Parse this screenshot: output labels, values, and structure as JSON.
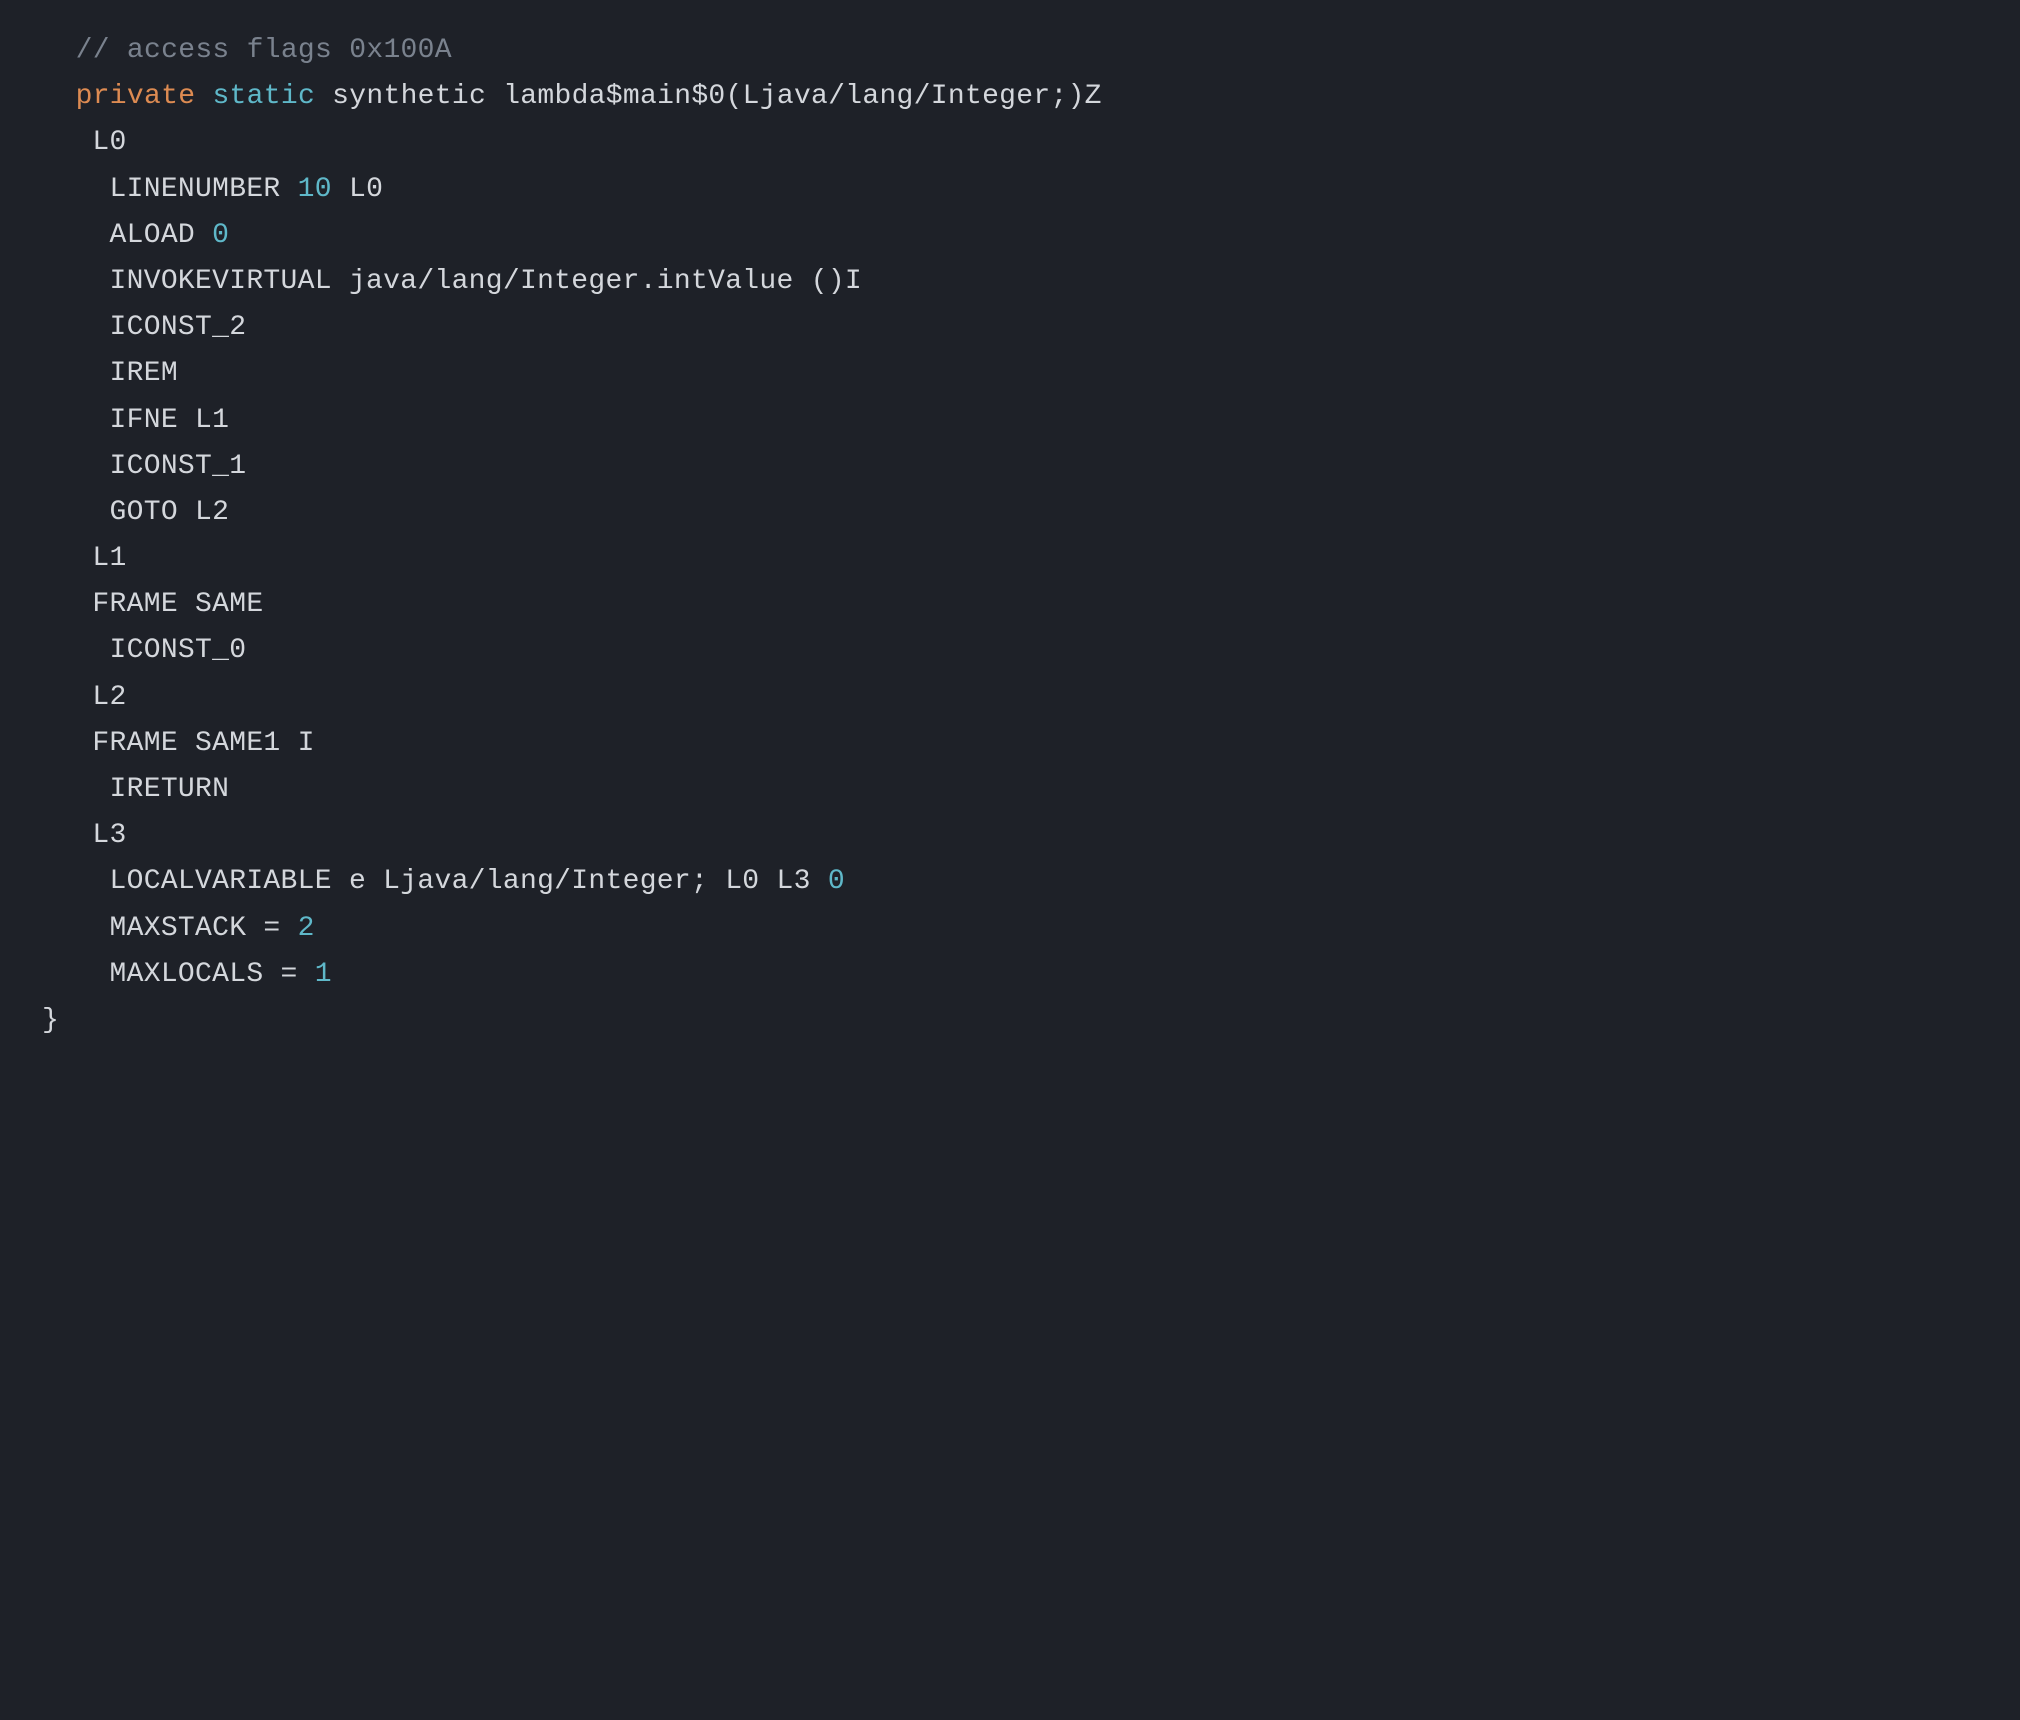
{
  "lines": [
    {
      "indent": "i2",
      "spans": [
        {
          "cls": "comment",
          "text": "// access flags 0x100A"
        }
      ]
    },
    {
      "indent": "i2",
      "spans": [
        {
          "cls": "keyword1",
          "text": "private"
        },
        {
          "cls": "text",
          "text": " "
        },
        {
          "cls": "keyword2",
          "text": "static"
        },
        {
          "cls": "text",
          "text": " synthetic lambda$main$0(Ljava/lang/Integer;)Z"
        }
      ]
    },
    {
      "indent": "i3",
      "spans": [
        {
          "cls": "text",
          "text": "L0"
        }
      ]
    },
    {
      "indent": "i3",
      "spans": [
        {
          "cls": "text",
          "text": " LINENUMBER "
        },
        {
          "cls": "number",
          "text": "10"
        },
        {
          "cls": "text",
          "text": " L0"
        }
      ]
    },
    {
      "indent": "i3",
      "spans": [
        {
          "cls": "text",
          "text": " ALOAD "
        },
        {
          "cls": "number",
          "text": "0"
        }
      ]
    },
    {
      "indent": "i3",
      "spans": [
        {
          "cls": "text",
          "text": " INVOKEVIRTUAL java/lang/Integer.intValue ()I"
        }
      ]
    },
    {
      "indent": "i3",
      "spans": [
        {
          "cls": "text",
          "text": " ICONST_2"
        }
      ]
    },
    {
      "indent": "i3",
      "spans": [
        {
          "cls": "text",
          "text": " IREM"
        }
      ]
    },
    {
      "indent": "i3",
      "spans": [
        {
          "cls": "text",
          "text": " IFNE L1"
        }
      ]
    },
    {
      "indent": "i3",
      "spans": [
        {
          "cls": "text",
          "text": " ICONST_1"
        }
      ]
    },
    {
      "indent": "i3",
      "spans": [
        {
          "cls": "text",
          "text": " GOTO L2"
        }
      ]
    },
    {
      "indent": "i3",
      "spans": [
        {
          "cls": "text",
          "text": "L1"
        }
      ]
    },
    {
      "indent": "i3",
      "spans": [
        {
          "cls": "text",
          "text": "FRAME SAME"
        }
      ]
    },
    {
      "indent": "i3",
      "spans": [
        {
          "cls": "text",
          "text": " ICONST_0"
        }
      ]
    },
    {
      "indent": "i3",
      "spans": [
        {
          "cls": "text",
          "text": "L2"
        }
      ]
    },
    {
      "indent": "i3",
      "spans": [
        {
          "cls": "text",
          "text": "FRAME SAME1 I"
        }
      ]
    },
    {
      "indent": "i3",
      "spans": [
        {
          "cls": "text",
          "text": " IRETURN"
        }
      ]
    },
    {
      "indent": "i3",
      "spans": [
        {
          "cls": "text",
          "text": "L3"
        }
      ]
    },
    {
      "indent": "i3",
      "spans": [
        {
          "cls": "text",
          "text": " LOCALVARIABLE e Ljava/lang/Integer; L0 L3 "
        },
        {
          "cls": "number",
          "text": "0"
        }
      ]
    },
    {
      "indent": "i3",
      "spans": [
        {
          "cls": "text",
          "text": " MAXSTACK = "
        },
        {
          "cls": "number",
          "text": "2"
        }
      ]
    },
    {
      "indent": "i3",
      "spans": [
        {
          "cls": "text",
          "text": " MAXLOCALS = "
        },
        {
          "cls": "number",
          "text": "1"
        }
      ]
    },
    {
      "indent": "i0",
      "spans": [
        {
          "cls": "text",
          "text": "}"
        }
      ]
    }
  ]
}
